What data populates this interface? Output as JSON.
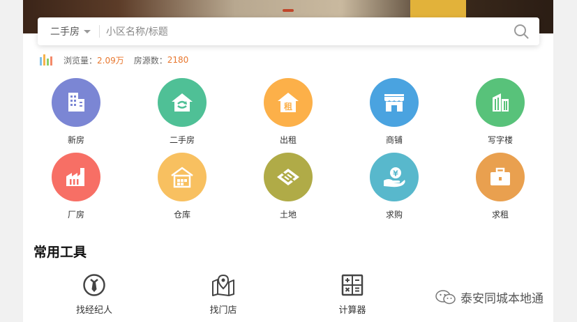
{
  "search": {
    "type_label": "二手房",
    "placeholder": "小区名称/标题"
  },
  "stats": {
    "views_label": "浏览量：",
    "views_value": "2.09万",
    "listings_label": "房源数：",
    "listings_value": "2180"
  },
  "categories": [
    {
      "label": "新房",
      "icon": "building-icon",
      "color": "#7b86d4"
    },
    {
      "label": "二手房",
      "icon": "house-exchange-icon",
      "color": "#4fc096"
    },
    {
      "label": "出租",
      "icon": "rent-house-icon",
      "color": "#fcb049"
    },
    {
      "label": "商铺",
      "icon": "shop-icon",
      "color": "#4aa3e0"
    },
    {
      "label": "写字楼",
      "icon": "office-building-icon",
      "color": "#58c27a"
    },
    {
      "label": "厂房",
      "icon": "factory-icon",
      "color": "#f76f65"
    },
    {
      "label": "仓库",
      "icon": "warehouse-icon",
      "color": "#f8c060"
    },
    {
      "label": "土地",
      "icon": "land-icon",
      "color": "#b0ab47"
    },
    {
      "label": "求购",
      "icon": "hand-money-icon",
      "color": "#58b8cc"
    },
    {
      "label": "求租",
      "icon": "briefcase-icon",
      "color": "#e9a04f"
    }
  ],
  "tools": {
    "title": "常用工具",
    "items": [
      {
        "label": "找经纪人",
        "icon": "agent-icon"
      },
      {
        "label": "找门店",
        "icon": "map-pin-icon"
      },
      {
        "label": "计算器",
        "icon": "calculator-icon"
      }
    ]
  },
  "watermark": {
    "text": "泰安同城本地通"
  }
}
